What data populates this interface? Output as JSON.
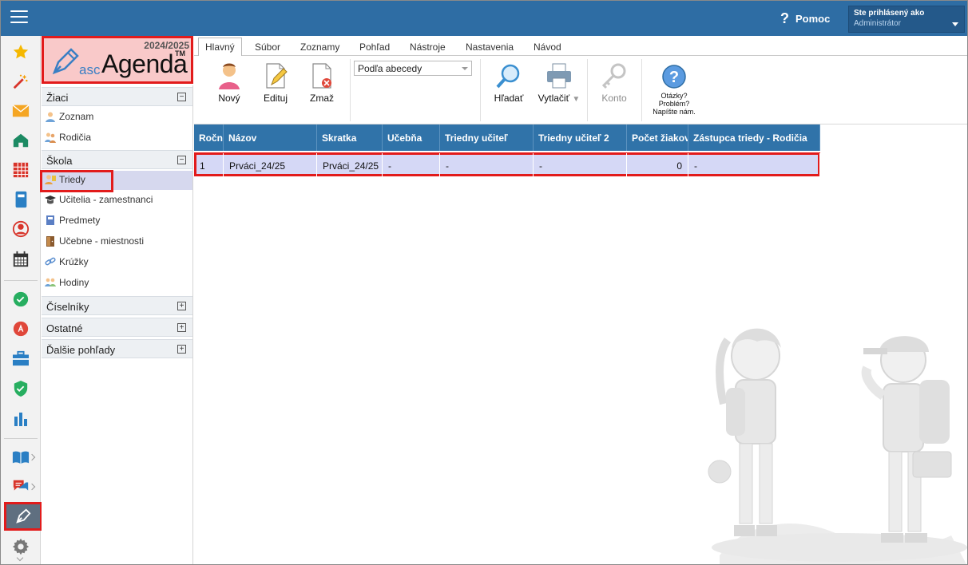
{
  "header": {
    "help_label": "Pomoc",
    "help_icon": "question-mark-icon",
    "user_line1": "Ste prihlásený ako",
    "user_line2": "Administrátor"
  },
  "logo": {
    "year": "2024/2025",
    "asc": "asc",
    "name": "Agenda",
    "tm": "TM"
  },
  "nav": {
    "groups": [
      {
        "label": "Žiaci",
        "toggle": "−"
      },
      {
        "label": "Škola",
        "toggle": "−"
      },
      {
        "label": "Číselníky",
        "toggle": "+"
      },
      {
        "label": "Ostatné",
        "toggle": "+"
      },
      {
        "label": "Ďalšie pohľady",
        "toggle": "+"
      }
    ],
    "items": [
      {
        "label": "Zoznam"
      },
      {
        "label": "Rodičia"
      },
      {
        "label": "Triedy"
      },
      {
        "label": "Učitelia - zamestnanci"
      },
      {
        "label": "Predmety"
      },
      {
        "label": "Učebne - miestnosti"
      },
      {
        "label": "Krúžky"
      },
      {
        "label": "Hodiny"
      }
    ]
  },
  "tabs": [
    "Hlavný",
    "Súbor",
    "Zoznamy",
    "Pohľad",
    "Nástroje",
    "Nastavenia",
    "Návod"
  ],
  "ribbon": {
    "new_label": "Nový",
    "edit_label": "Edituj",
    "delete_label": "Zmaž",
    "sort_select": "Podľa abecedy",
    "search_label": "Hľadať",
    "print_label": "Vytlačiť",
    "account_label": "Konto",
    "help_text_1": "Otázky?",
    "help_text_2": "Problém?",
    "help_text_3": "Napíšte nám."
  },
  "table": {
    "columns": [
      "Roční",
      "Názov",
      "Skratka",
      "Učebňa",
      "Triedny učiteľ",
      "Triedny učiteľ 2",
      "Počet žiakov",
      "Zástupca triedy - Rodičia"
    ],
    "rows": [
      [
        "1",
        "Prváci_24/25",
        "Prváci_24/25",
        "-",
        "-",
        "-",
        "0",
        "-"
      ]
    ]
  }
}
